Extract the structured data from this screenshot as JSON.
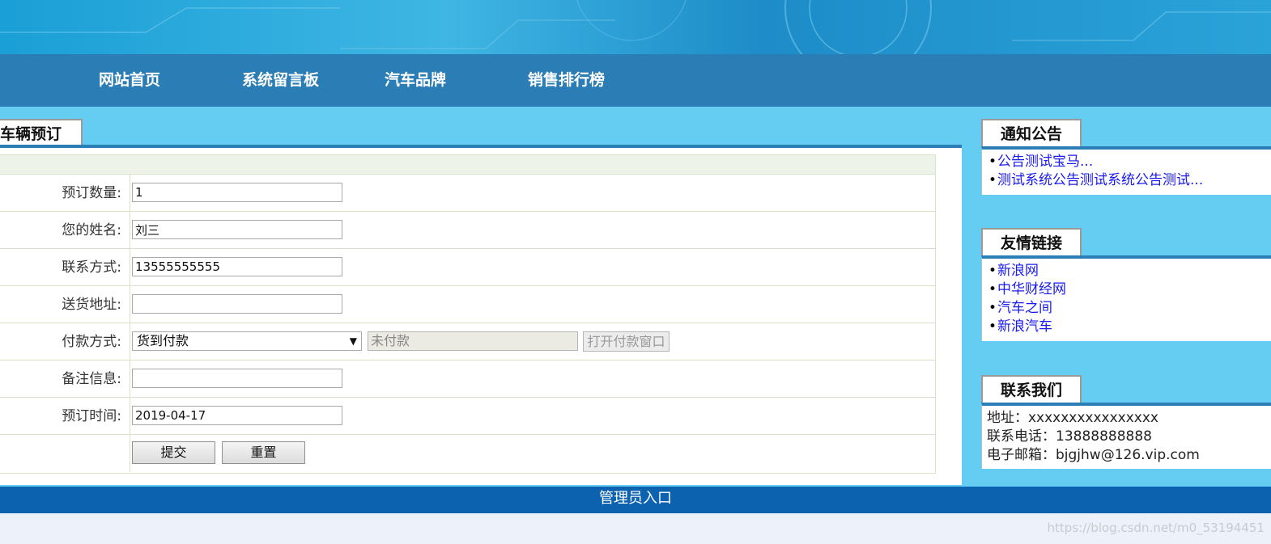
{
  "nav": {
    "items": [
      {
        "label": "网站首页"
      },
      {
        "label": "系统留言板"
      },
      {
        "label": "汽车品牌"
      },
      {
        "label": "销售排行榜"
      }
    ]
  },
  "main": {
    "title": "车辆预订",
    "form": {
      "quantity_label": "预订数量:",
      "quantity_value": "1",
      "name_label": "您的姓名:",
      "name_value": "刘三",
      "contact_label": "联系方式:",
      "contact_value": "13555555555",
      "address_label": "送货地址:",
      "address_value": "",
      "payment_label": "付款方式:",
      "payment_selected": "货到付款",
      "payment_status": "未付款",
      "open_payment_button": "打开付款窗口",
      "remark_label": "备注信息:",
      "remark_value": "",
      "date_label": "预订时间:",
      "date_value": "2019-04-17",
      "submit_button": "提交",
      "reset_button": "重置"
    }
  },
  "sidebar": {
    "notice": {
      "title": "通知公告",
      "items": [
        "公告测试宝马...",
        "测试系统公告测试系统公告测试..."
      ]
    },
    "links": {
      "title": "友情链接",
      "items": [
        "新浪网",
        "中华财经网",
        "汽车之间",
        "新浪汽车"
      ]
    },
    "contact": {
      "title": "联系我们",
      "address": "地址：xxxxxxxxxxxxxxxx",
      "phone": "联系电话：13888888888",
      "email": "电子邮箱：bjgjhw@126.vip.com"
    }
  },
  "footer": {
    "admin_link": "管理员入口"
  },
  "watermark": "https://blog.csdn.net/m0_53194451",
  "colors": {
    "nav_bg": "#2a7db5",
    "content_bg": "#66cdf2",
    "footer_bg": "#0d62b0",
    "link": "#1a1aee"
  }
}
